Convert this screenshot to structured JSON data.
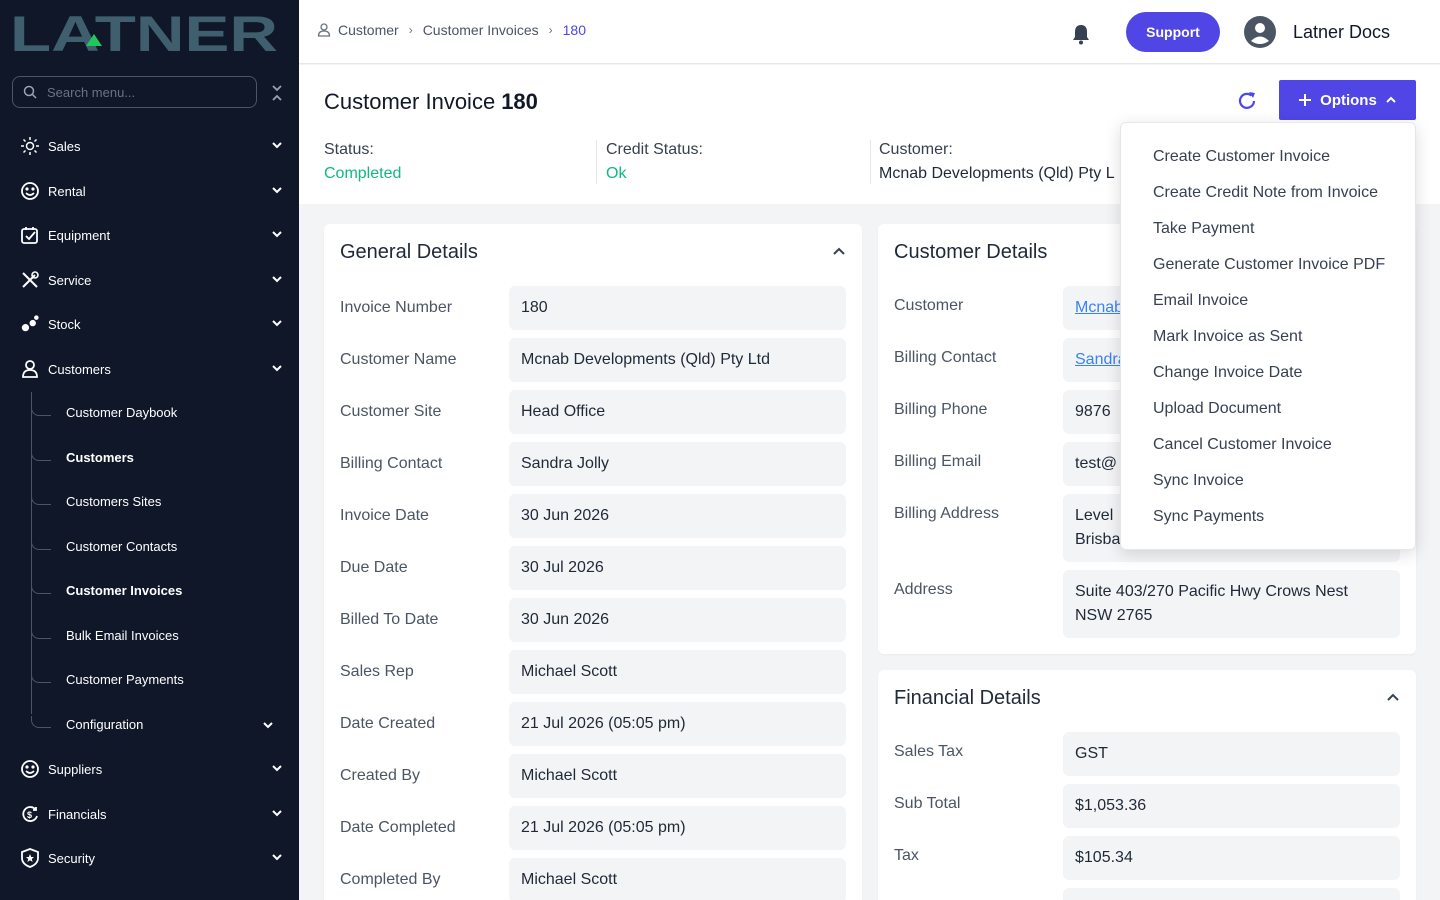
{
  "app": {
    "logo_text": "LATNER"
  },
  "sidebar": {
    "search_placeholder": "Search menu...",
    "items": [
      {
        "label": "Sales",
        "icon": "sales-icon"
      },
      {
        "label": "Rental",
        "icon": "rental-icon"
      },
      {
        "label": "Equipment",
        "icon": "equipment-icon"
      },
      {
        "label": "Service",
        "icon": "service-icon"
      },
      {
        "label": "Stock",
        "icon": "stock-icon"
      },
      {
        "label": "Customers",
        "icon": "user-icon"
      },
      {
        "label": "Suppliers",
        "icon": "suppliers-icon"
      },
      {
        "label": "Financials",
        "icon": "financials-icon"
      },
      {
        "label": "Security",
        "icon": "shield-icon"
      }
    ],
    "customers_sub": [
      {
        "label": "Customer Daybook"
      },
      {
        "label": "Customers"
      },
      {
        "label": "Customers Sites"
      },
      {
        "label": "Customer Contacts"
      },
      {
        "label": "Customer Invoices"
      },
      {
        "label": "Bulk Email Invoices"
      },
      {
        "label": "Customer Payments"
      },
      {
        "label": "Configuration"
      }
    ]
  },
  "topbar": {
    "breadcrumb": [
      "Customer",
      "Customer Invoices",
      "180"
    ],
    "support_label": "Support",
    "username": "Latner Docs"
  },
  "header": {
    "title": "Customer Invoice",
    "number": "180",
    "options_label": "Options",
    "status_label": "Status:",
    "status_value": "Completed",
    "credit_label": "Credit Status:",
    "credit_value": "Ok",
    "customer_label": "Customer:",
    "customer_value": "Mcnab Developments (Qld) Pty L"
  },
  "general": {
    "title": "General Details",
    "fields": [
      {
        "label": "Invoice Number",
        "value": "180"
      },
      {
        "label": "Customer Name",
        "value": "Mcnab Developments (Qld) Pty Ltd"
      },
      {
        "label": "Customer Site",
        "value": "Head Office"
      },
      {
        "label": "Billing Contact",
        "value": "Sandra Jolly"
      },
      {
        "label": "Invoice Date",
        "value": "30 Jun 2026"
      },
      {
        "label": "Due Date",
        "value": "30 Jul 2026"
      },
      {
        "label": "Billed To Date",
        "value": "30 Jun 2026"
      },
      {
        "label": "Sales Rep",
        "value": "Michael Scott"
      },
      {
        "label": "Date Created",
        "value": "21 Jul 2026 (05:05 pm)"
      },
      {
        "label": "Created By",
        "value": "Michael Scott"
      },
      {
        "label": "Date Completed",
        "value": "21 Jul 2026 (05:05 pm)"
      },
      {
        "label": "Completed By",
        "value": "Michael Scott"
      }
    ]
  },
  "customer_details": {
    "title": "Customer Details",
    "fields": [
      {
        "label": "Customer",
        "value": "Mcnab"
      },
      {
        "label": "Billing Contact",
        "value": "Sandra"
      },
      {
        "label": "Billing Phone",
        "value": "9876"
      },
      {
        "label": "Billing Email",
        "value": "test@"
      },
      {
        "label": "Billing Address",
        "value": "Level",
        "value2": "Brisba"
      },
      {
        "label": "Address",
        "value": "Suite 403/270 Pacific Hwy Crows Nest",
        "value2": "NSW 2765"
      }
    ]
  },
  "financial": {
    "title": "Financial Details",
    "fields": [
      {
        "label": "Sales Tax",
        "value": "GST"
      },
      {
        "label": "Sub Total",
        "value": "$1,053.36"
      },
      {
        "label": "Tax",
        "value": "$105.34"
      }
    ]
  },
  "options_menu": [
    "Create Customer Invoice",
    "Create Credit Note from Invoice",
    "Take Payment",
    "Generate Customer Invoice PDF",
    "Email Invoice",
    "Mark Invoice as Sent",
    "Change Invoice Date",
    "Upload Document",
    "Cancel Customer Invoice",
    "Sync Invoice",
    "Sync Payments"
  ],
  "colors": {
    "accent": "#4f46e5",
    "success": "#10b981",
    "sidebar": "#0f1729",
    "logo": "#3f5f6f",
    "logo_triangle": "#22c55e"
  }
}
